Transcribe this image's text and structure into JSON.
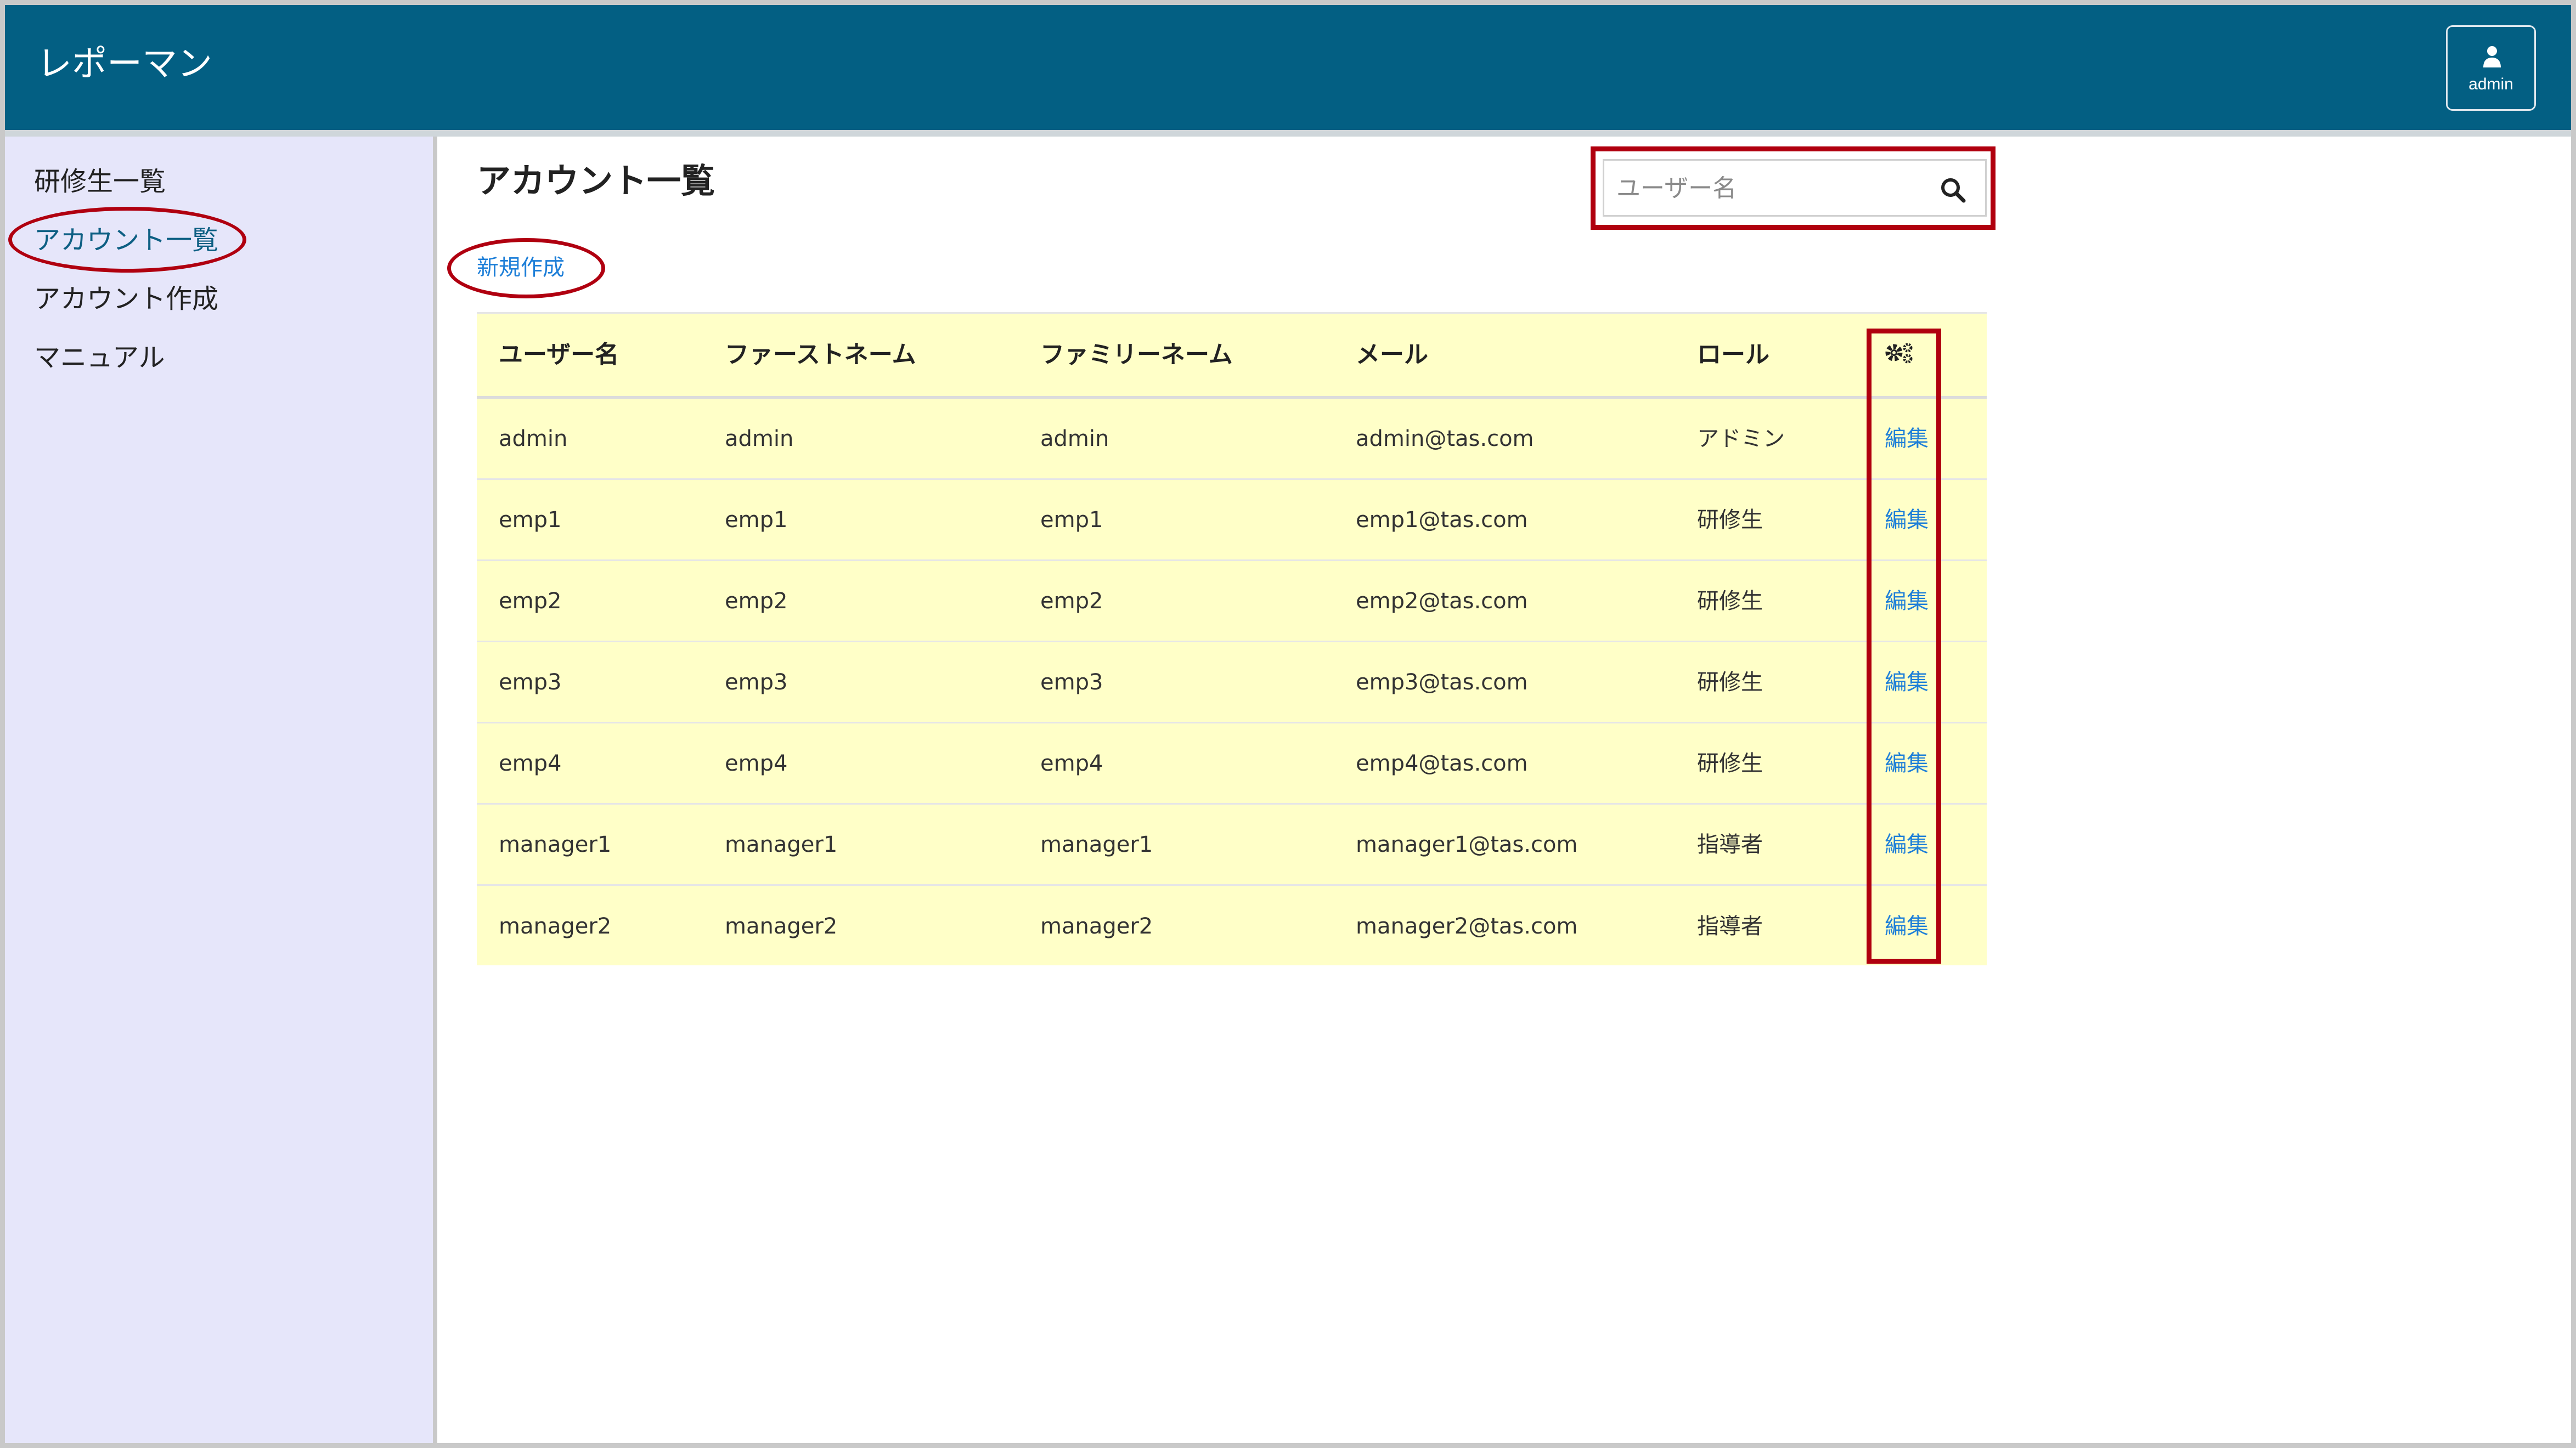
{
  "app": {
    "title": "レポーマン",
    "user_label": "admin"
  },
  "sidebar": {
    "items": [
      {
        "label": "研修生一覧"
      },
      {
        "label": "アカウント一覧",
        "active": true
      },
      {
        "label": "アカウント作成"
      },
      {
        "label": "マニュアル"
      }
    ]
  },
  "main": {
    "title": "アカウント一覧",
    "new_label": "新規作成",
    "search": {
      "placeholder": "ユーザー名",
      "value": ""
    }
  },
  "table": {
    "columns": [
      "ユーザー名",
      "ファーストネーム",
      "ファミリーネーム",
      "メール",
      "ロール"
    ],
    "action_icon": "gears-icon",
    "edit_label": "編集",
    "rows": [
      [
        "admin",
        "admin",
        "admin",
        "admin@tas.com",
        "アドミン"
      ],
      [
        "emp1",
        "emp1",
        "emp1",
        "emp1@tas.com",
        "研修生"
      ],
      [
        "emp2",
        "emp2",
        "emp2",
        "emp2@tas.com",
        "研修生"
      ],
      [
        "emp3",
        "emp3",
        "emp3",
        "emp3@tas.com",
        "研修生"
      ],
      [
        "emp4",
        "emp4",
        "emp4",
        "emp4@tas.com",
        "研修生"
      ],
      [
        "manager1",
        "manager1",
        "manager1",
        "manager1@tas.com",
        "指導者"
      ],
      [
        "manager2",
        "manager2",
        "manager2",
        "manager2@tas.com",
        "指導者"
      ]
    ]
  },
  "colors": {
    "header": "#035f83",
    "sidebar": "#e6e6fa",
    "table_bg": "#ffffc8",
    "link": "#1e7fd8",
    "annotation": "#b0000e"
  }
}
